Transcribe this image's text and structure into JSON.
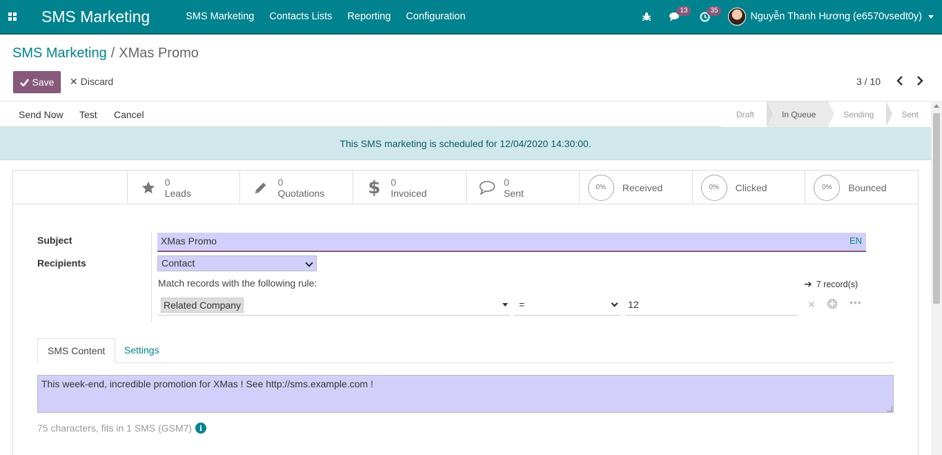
{
  "navbar": {
    "app_title": "SMS Marketing",
    "menu": [
      "SMS Marketing",
      "Contacts Lists",
      "Reporting",
      "Configuration"
    ],
    "chat_count": "13",
    "activity_count": "35",
    "user_name": "Nguyễn Thanh Hương (e6570vsedt0y)"
  },
  "breadcrumb": {
    "parent": "SMS Marketing",
    "separator": "/",
    "current": "XMas Promo"
  },
  "buttons": {
    "save": "Save",
    "discard": "Discard"
  },
  "pager": {
    "value": "3 / 10"
  },
  "header_buttons": [
    "Send Now",
    "Test",
    "Cancel"
  ],
  "statusbar": {
    "stages": [
      "Draft",
      "In Queue",
      "Sending",
      "Sent"
    ],
    "active": "In Queue"
  },
  "alert": {
    "text": "This SMS marketing is scheduled for 12/04/2020 14:30:00."
  },
  "stats": [
    {
      "value": "0",
      "label": "Leads",
      "icon": "star-icon"
    },
    {
      "value": "0",
      "label": "Quotations",
      "icon": "pencil-icon"
    },
    {
      "value": "0",
      "label": "Invoiced",
      "icon": "dollar-icon"
    },
    {
      "value": "0",
      "label": "Sent",
      "icon": "comment-icon"
    },
    {
      "value": "0%",
      "label": "Received"
    },
    {
      "value": "0%",
      "label": "Clicked"
    },
    {
      "value": "0%",
      "label": "Bounced"
    }
  ],
  "form": {
    "subject_label": "Subject",
    "subject_value": "XMas Promo",
    "lang": "EN",
    "recipients_label": "Recipients",
    "recipients_value": "Contact",
    "match_text": "Match records with the following rule:",
    "records_count": "7 record(s)",
    "domain": {
      "field": "Related Company",
      "operator": "=",
      "value": "12"
    }
  },
  "tabs": [
    "SMS Content",
    "Settings"
  ],
  "sms": {
    "body": "This week-end, incredible promotion for XMas ! See http://sms.example.com !",
    "char_info": "75 characters, fits in 1 SMS (GSM7)"
  },
  "colors": {
    "navbar": "#00838f",
    "primary": "#875a7b",
    "field_bg": "#d2d0fa",
    "alert_bg": "#d0e8ec"
  }
}
